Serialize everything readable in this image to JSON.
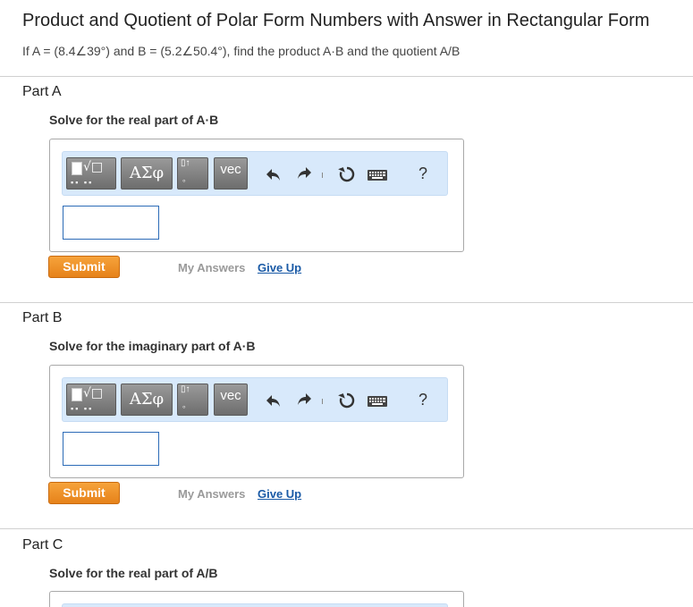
{
  "header": {
    "title": "Product and Quotient of Polar Form Numbers with Answer in Rectangular Form",
    "problem": "If A = (8.4∠39°) and B = (5.2∠50.4°), find the product A·B and the quotient A/B"
  },
  "toolbar": {
    "templates_icon": "sqrt-template-icon",
    "greek_label": "ΑΣφ",
    "vec_label": "vec",
    "help_label": "?",
    "undo_icon": "undo-icon",
    "redo_icon": "redo-icon",
    "reset_icon": "reset-icon",
    "keyboard_icon": "keyboard-icon"
  },
  "actions": {
    "submit_label": "Submit",
    "my_answers_label": "My Answers",
    "give_up_label": "Give Up"
  },
  "parts": [
    {
      "title": "Part A",
      "prompt": "Solve for the real part of A·B",
      "answer": ""
    },
    {
      "title": "Part B",
      "prompt": "Solve for the imaginary part of A·B",
      "answer": ""
    },
    {
      "title": "Part C",
      "prompt": "Solve for the real part of A/B",
      "answer": ""
    }
  ],
  "colors": {
    "submit": "#f08a24",
    "toolbar_bg": "#d8e9fb",
    "link": "#1a5aa6",
    "input_border": "#2c6bb7"
  }
}
